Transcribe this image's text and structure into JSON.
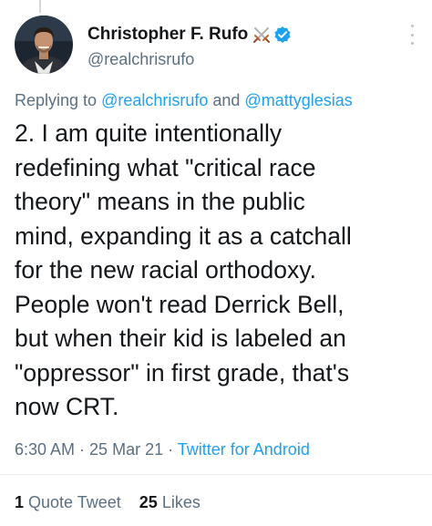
{
  "tweet": {
    "author": {
      "display_name": "Christopher F. Rufo",
      "handle": "@realchrisrufo",
      "verified": true,
      "badge_icon": "crossed-swords-icon",
      "verified_icon": "verified-badge-icon",
      "verified_color": "#1da1f2"
    },
    "replying": {
      "prefix": "Replying to ",
      "user1": "@realchrisrufo",
      "joiner": " and ",
      "user2": "@mattyglesias"
    },
    "text": "2. I am quite intentionally\nredefining what \"critical race\ntheory\" means in the public\nmind, expanding it as a catchall\nfor the new racial orthodoxy.\nPeople won't read Derrick Bell,\nbut when their kid is labeled an\n\"oppressor\" in first grade, that's\nnow CRT.",
    "time": "6:30 AM",
    "separator": " · ",
    "date": "25 Mar 21",
    "client": "Twitter for Android",
    "stats": {
      "quote_count": "1",
      "quote_label": "Quote Tweet",
      "like_count": "25",
      "like_label": "Likes"
    }
  },
  "colors": {
    "link": "#1da1f2",
    "secondary_text": "#5b7083",
    "primary_text": "#14171a"
  }
}
